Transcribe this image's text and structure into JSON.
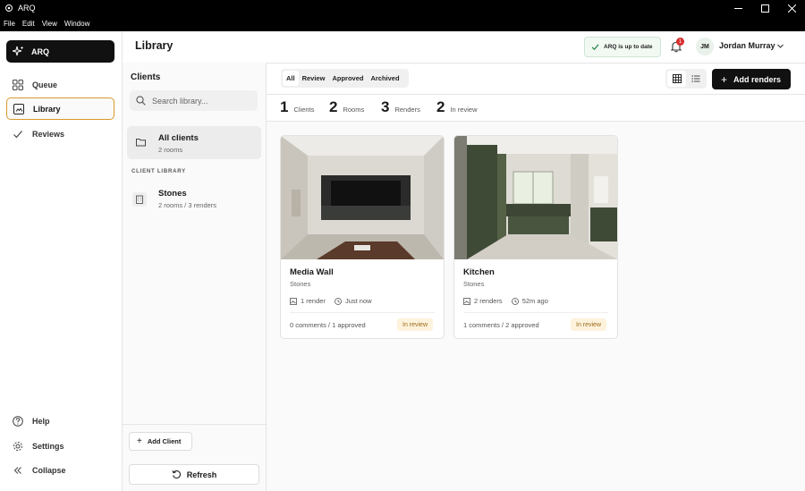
{
  "window": {
    "title": "ARQ"
  },
  "menu": [
    "File",
    "Edit",
    "View",
    "Window"
  ],
  "sidebar": {
    "brand": "ARQ",
    "nav": [
      {
        "label": "Queue",
        "icon": "grid-icon"
      },
      {
        "label": "Library",
        "icon": "library-icon",
        "active": true
      },
      {
        "label": "Reviews",
        "icon": "check-icon"
      }
    ],
    "bottom": [
      {
        "label": "Help",
        "icon": "help-icon"
      },
      {
        "label": "Settings",
        "icon": "gear-icon"
      },
      {
        "label": "Collapse",
        "icon": "collapse-icon"
      }
    ]
  },
  "header": {
    "title": "Library",
    "status": "ARQ is up to date",
    "notifications": "1",
    "user_initials": "JM",
    "user_name": "Jordan Murray"
  },
  "clients_panel": {
    "title": "Clients",
    "search_placeholder": "Search library...",
    "all_clients": {
      "name": "All clients",
      "sub": "2 rooms"
    },
    "section_label": "CLIENT LIBRARY",
    "clients": [
      {
        "name": "Stones",
        "sub": "2 rooms / 3 renders"
      }
    ],
    "add_client": "Add Client",
    "refresh": "Refresh"
  },
  "filters": {
    "tabs": [
      "All",
      "Review",
      "Approved",
      "Archived"
    ],
    "active": "All",
    "add_renders": "Add renders"
  },
  "stats": [
    {
      "value": "1",
      "label": "Clients"
    },
    {
      "value": "2",
      "label": "Rooms"
    },
    {
      "value": "3",
      "label": "Renders"
    },
    {
      "value": "2",
      "label": "In review"
    }
  ],
  "cards": [
    {
      "title": "Media Wall",
      "client": "Stones",
      "renders": "1 render",
      "time": "Just now",
      "comments": "0 comments / 1 approved",
      "status": "In review"
    },
    {
      "title": "Kitchen",
      "client": "Stones",
      "renders": "2 renders",
      "time": "52m ago",
      "comments": "1 comments / 2 approved",
      "status": "In review"
    }
  ],
  "colors": {
    "accent": "#d99a2b",
    "brand_bg": "#111111",
    "badge_bg": "#fdf2dc",
    "status_green": "#2e8b4e"
  }
}
